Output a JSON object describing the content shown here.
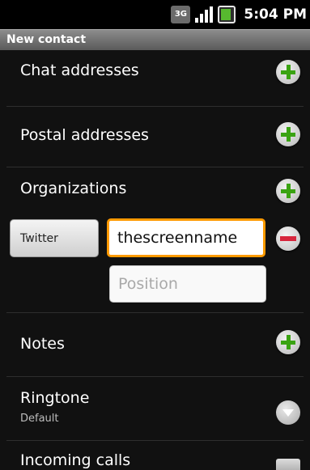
{
  "status_bar": {
    "network": "3G",
    "time": "5:04 PM"
  },
  "title_bar": {
    "title": "New contact"
  },
  "sections": {
    "chat_addresses": "Chat addresses",
    "postal_addresses": "Postal addresses",
    "organizations": "Organizations",
    "notes": "Notes",
    "ringtone": {
      "label": "Ringtone",
      "value": "Default"
    },
    "incoming_calls": "Incoming calls"
  },
  "organization_entry": {
    "type_label": "Twitter",
    "company_value": "thescreenname",
    "position_placeholder": "Position"
  },
  "colors": {
    "add_green": "#3aa312",
    "remove_red": "#d7263d",
    "focus_orange": "#ff9a00"
  }
}
